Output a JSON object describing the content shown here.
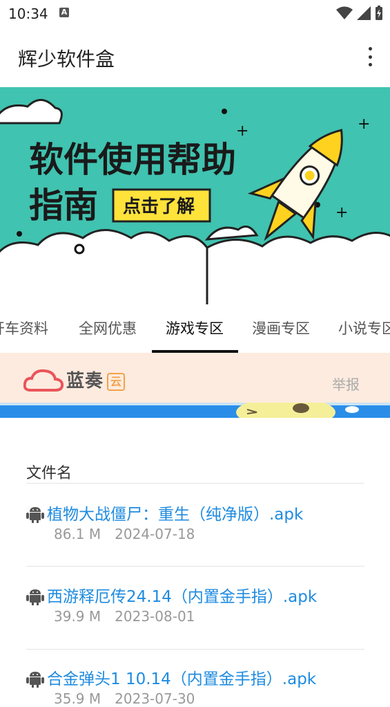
{
  "status": {
    "time": "10:34",
    "indicator": "A"
  },
  "app": {
    "title": "辉少软件盒"
  },
  "banner": {
    "line1": "软件使用帮助",
    "line2": "指南",
    "cta": "点击了解",
    "colors": {
      "bg": "#40c3b0",
      "cta": "#ffe23a",
      "text": "#1a1a1a"
    }
  },
  "tabs": [
    {
      "label": "开车资料"
    },
    {
      "label": "全网优惠"
    },
    {
      "label": "游戏专区",
      "active": true
    },
    {
      "label": "漫画专区"
    },
    {
      "label": "小说专区"
    }
  ],
  "lanzou": {
    "brand": "蓝奏",
    "yun": "云",
    "report": "举报"
  },
  "list": {
    "header": "文件名",
    "files": [
      {
        "name": "植物大战僵尸：重生（纯净版）.apk",
        "size": "86.1 M",
        "date": "2024-07-18"
      },
      {
        "name": "西游释厄传24.14（内置金手指）.apk",
        "size": "39.9 M",
        "date": "2023-08-01"
      },
      {
        "name": "合金弹头1 10.14（内置金手指）.apk",
        "size": "35.9 M",
        "date": "2023-07-30"
      }
    ]
  }
}
